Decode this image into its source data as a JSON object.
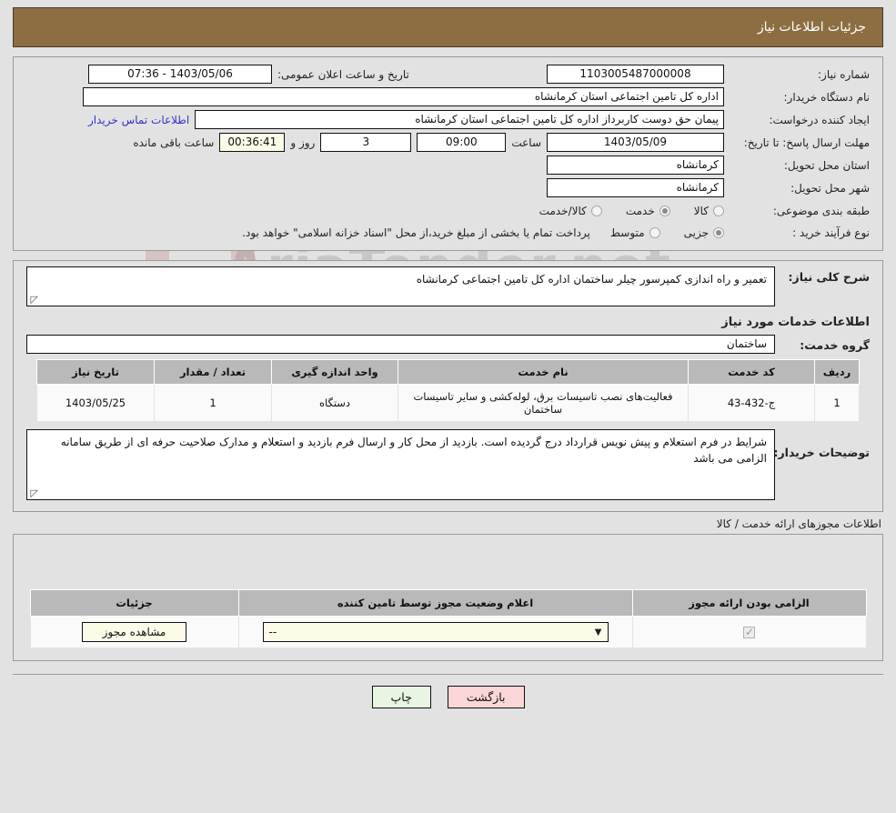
{
  "header": {
    "title": "جزئیات اطلاعات نیاز"
  },
  "watermark": {
    "text": "AriaTender.net"
  },
  "form": {
    "need_number": {
      "label": "شماره نیاز:",
      "value": "1103005487000008"
    },
    "announce_datetime": {
      "label": "تاریخ و ساعت اعلان عمومی:",
      "value": "1403/05/06 - 07:36"
    },
    "buyer_org": {
      "label": "نام دستگاه خریدار:",
      "value": "اداره کل تامین اجتماعی استان کرمانشاه"
    },
    "requester": {
      "label": "ایجاد کننده درخواست:",
      "value": "پیمان حق دوست کاربرداز اداره کل تامین اجتماعی استان کرمانشاه"
    },
    "contact_link": "اطلاعات تماس خریدار",
    "deadline": {
      "label": "مهلت ارسال پاسخ: تا تاریخ:",
      "date": "1403/05/09",
      "time_label": "ساعت",
      "time": "09:00",
      "days": "3",
      "days_label": "روز و",
      "countdown": "00:36:41",
      "remaining_label": "ساعت باقی مانده"
    },
    "delivery_province": {
      "label": "استان محل تحویل:",
      "value": "کرمانشاه"
    },
    "delivery_city": {
      "label": "شهر محل تحویل:",
      "value": "کرمانشاه"
    },
    "subject_category": {
      "label": "طبقه بندی موضوعی:",
      "options": [
        {
          "label": "کالا",
          "selected": false
        },
        {
          "label": "خدمت",
          "selected": true
        },
        {
          "label": "کالا/خدمت",
          "selected": false
        }
      ]
    },
    "purchase_type": {
      "label": "نوع فرآیند خرید :",
      "options": [
        {
          "label": "جزیی",
          "selected": true
        },
        {
          "label": "متوسط",
          "selected": false
        }
      ],
      "note": "پرداخت تمام یا بخشی از مبلغ خرید،از محل \"اسناد خزانه اسلامی\" خواهد بود."
    }
  },
  "description": {
    "general_label": "شرح کلی نیاز:",
    "general_value": "تعمیر و راه اندازی کمپرسور چیلر ساختمان اداره کل تامین اجتماعی کرمانشاه",
    "services_heading": "اطلاعات خدمات مورد نیاز",
    "group_label": "گروه خدمت:",
    "group_value": "ساختمان"
  },
  "service_table": {
    "columns": [
      "ردیف",
      "کد خدمت",
      "نام خدمت",
      "واحد اندازه گیری",
      "تعداد / مقدار",
      "تاریخ نیاز"
    ],
    "rows": [
      {
        "index": "1",
        "code": "ج-432-43",
        "name": "فعالیت‌های نصب تاسیسات برق، لوله‌کشی و سایر تاسیسات ساختمان",
        "unit": "دستگاه",
        "quantity": "1",
        "need_date": "1403/05/25"
      }
    ]
  },
  "buyer_notes": {
    "label": "توضیحات خریدار:",
    "value": "شرایط در فرم استعلام و پیش نویس قرارداد درج گردیده است. بازدید از محل کار و ارسال فرم بازدید و استعلام و مدارک صلاحیت حرفه ای از طریق سامانه الزامی می باشد"
  },
  "permits": {
    "caption": "اطلاعات مجوزهای ارائه خدمت / کالا",
    "columns": [
      "الزامی بودن ارائه مجوز",
      "اعلام وضعیت مجوز توسط تامین کننده",
      "جزئیات"
    ],
    "rows": [
      {
        "required_checked": true,
        "status_value": "--",
        "details_button": "مشاهده مجوز"
      }
    ]
  },
  "footer": {
    "back_button": "بازگشت",
    "print_button": "چاپ"
  }
}
